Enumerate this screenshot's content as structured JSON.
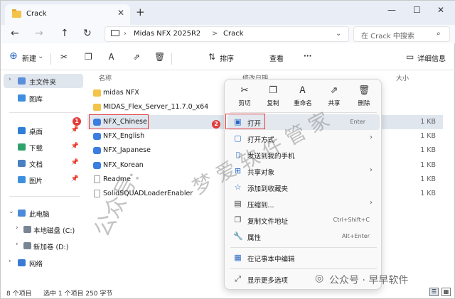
{
  "tabbar": {
    "tab_title": "Crack",
    "close": "✕",
    "new_tab": "+"
  },
  "window_controls": {
    "minimize": "—",
    "maximize": "☐",
    "close": "✕"
  },
  "address": {
    "segments": [
      "Midas NFX 2025R2",
      "Crack"
    ],
    "separator": ">",
    "search_placeholder": "在 Crack 中搜索"
  },
  "toolbar": {
    "new": "新建",
    "sort": "排序",
    "view": "查看",
    "more": "···",
    "details": "详细信息"
  },
  "sidebar": {
    "items": [
      {
        "label": "主文件夹"
      },
      {
        "label": "图库"
      },
      {
        "label": "桌面"
      },
      {
        "label": "下载"
      },
      {
        "label": "文档"
      },
      {
        "label": "图片"
      },
      {
        "label": "此电脑"
      },
      {
        "label": "本地磁盘 (C:)"
      },
      {
        "label": "新加卷 (D:)"
      },
      {
        "label": "网络"
      }
    ]
  },
  "file_list": {
    "headers": {
      "name": "名称",
      "date": "修改日期",
      "size": "大小"
    },
    "rows": [
      {
        "name": "midas NFX",
        "size": "",
        "type": "folder"
      },
      {
        "name": "MIDAS_Flex_Server_11.7.0_x64",
        "size": "",
        "type": "folder"
      },
      {
        "name": "NFX_Chinese",
        "size": "1 KB",
        "type": "exe"
      },
      {
        "name": "NFX_English",
        "size": "1 KB",
        "type": "exe"
      },
      {
        "name": "NFX_Japanese",
        "size": "1 KB",
        "type": "exe"
      },
      {
        "name": "NFX_Korean",
        "size": "1 KB",
        "type": "exe"
      },
      {
        "name": "Readme",
        "size": "1 KB",
        "type": "doc"
      },
      {
        "name": "SolidSQUADLoaderEnabler",
        "size": "1 KB",
        "type": "doc"
      }
    ]
  },
  "status": {
    "count": "8 个项目",
    "selection": "选中 1 个项目  250 字节"
  },
  "context_menu": {
    "quick_actions": [
      {
        "label": "剪切",
        "icon": "cut-icon"
      },
      {
        "label": "复制",
        "icon": "copy-icon"
      },
      {
        "label": "重命名",
        "icon": "rename-icon"
      },
      {
        "label": "共享",
        "icon": "share-icon"
      },
      {
        "label": "删除",
        "icon": "delete-icon"
      }
    ],
    "items": [
      {
        "label": "打开",
        "shortcut": "Enter",
        "arrow": ""
      },
      {
        "label": "打开方式",
        "shortcut": "",
        "arrow": "›"
      },
      {
        "label": "发送到我的手机",
        "shortcut": "",
        "arrow": ""
      },
      {
        "label": "共享对象",
        "shortcut": "",
        "arrow": "›"
      },
      {
        "label": "添加到收藏夹",
        "shortcut": "",
        "arrow": ""
      },
      {
        "label": "压缩到...",
        "shortcut": "",
        "arrow": "›"
      },
      {
        "label": "复制文件地址",
        "shortcut": "Ctrl+Shift+C",
        "arrow": ""
      },
      {
        "label": "属性",
        "shortcut": "Alt+Enter",
        "arrow": ""
      },
      {
        "label": "在记事本中编辑",
        "shortcut": "",
        "arrow": ""
      },
      {
        "label": "显示更多选项",
        "shortcut": "",
        "arrow": ""
      }
    ]
  },
  "annotations": {
    "badge1": "1",
    "badge2": "2"
  },
  "watermark": {
    "diagonal1": "公众号:",
    "diagonal2": "梦 爱 软 件 管 家",
    "bottom": "公众号 · 早早软件"
  },
  "colors": {
    "highlight": "#e23b3b",
    "selection": "#e0e6ee",
    "folder": "#f3c34a",
    "accent": "#2a6ac7"
  }
}
